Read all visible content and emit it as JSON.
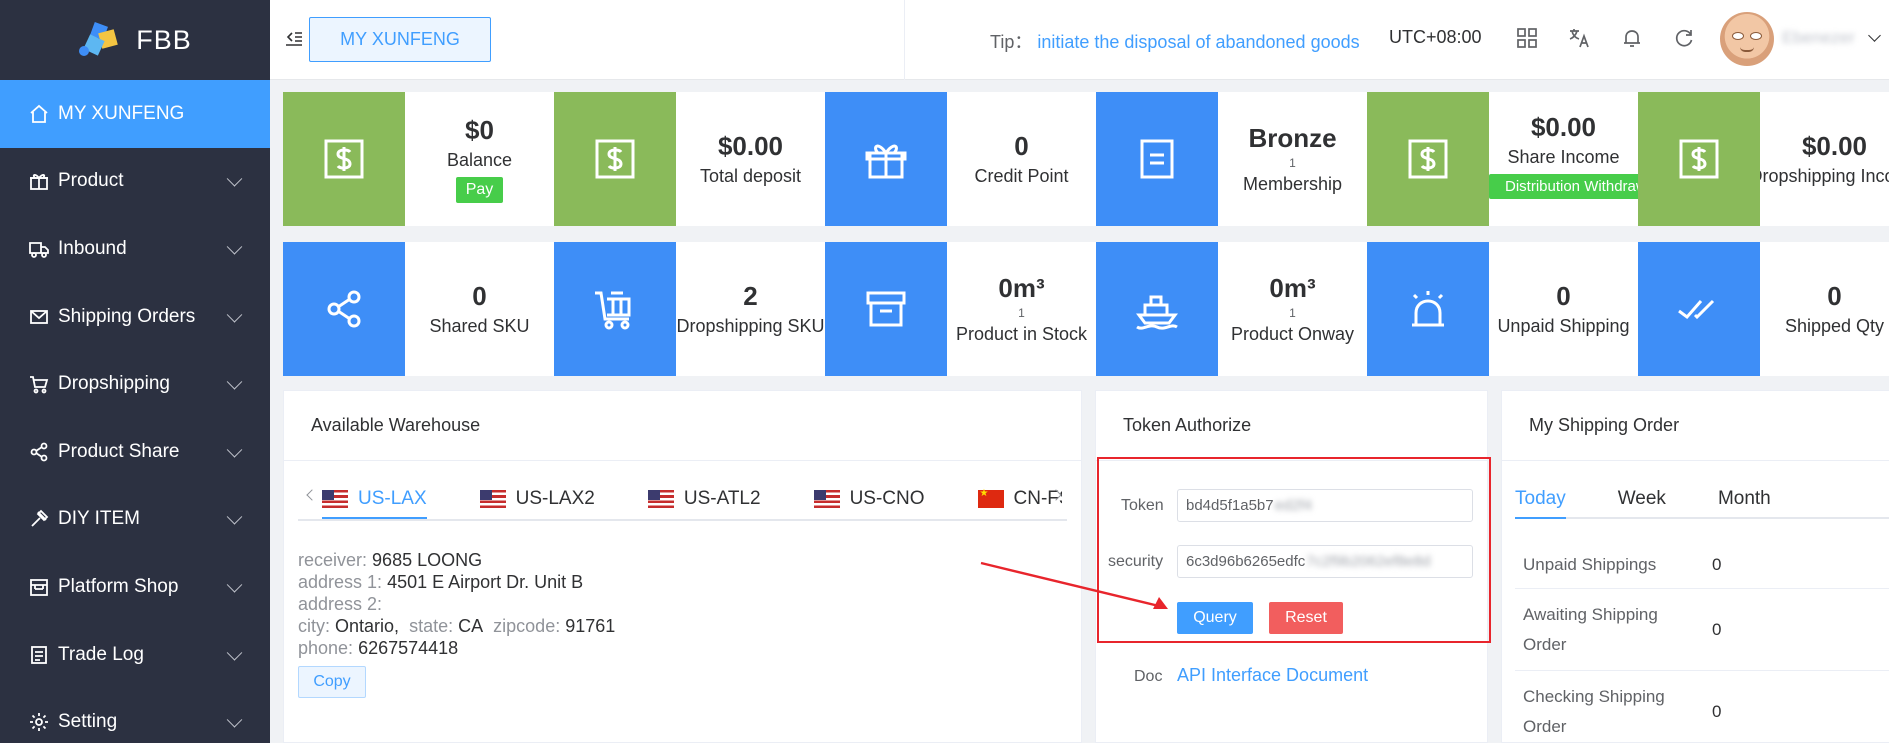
{
  "app": {
    "logo_text": "FBB"
  },
  "sidebar": {
    "items": [
      {
        "label": "MY XUNFENG",
        "icon": "home-icon"
      },
      {
        "label": "Product",
        "icon": "gift-icon"
      },
      {
        "label": "Inbound",
        "icon": "truck-icon"
      },
      {
        "label": "Shipping Orders",
        "icon": "mail-icon"
      },
      {
        "label": "Dropshipping",
        "icon": "cart-icon"
      },
      {
        "label": "Product Share",
        "icon": "share-icon"
      },
      {
        "label": "DIY ITEM",
        "icon": "tools-icon"
      },
      {
        "label": "Platform Shop",
        "icon": "shop-icon"
      },
      {
        "label": "Trade Log",
        "icon": "document-icon"
      },
      {
        "label": "Setting",
        "icon": "gear-icon"
      }
    ]
  },
  "header": {
    "active_tag": "MY XUNFENG",
    "tip_label": "Tip：",
    "tip_link": "initiate the disposal of abandoned goods",
    "timezone": "UTC+08:00",
    "username": "Ebenezer"
  },
  "stats_row1": [
    {
      "value": "$0",
      "label": "Balance",
      "button": "Pay",
      "color": "#8aba5a",
      "icon": "dollar-icon"
    },
    {
      "value": "$0.00",
      "label": "Total deposit",
      "color": "#8aba5a",
      "icon": "dollar-icon"
    },
    {
      "value": "0",
      "label": "Credit Point",
      "color": "#3e8ef7",
      "icon": "gift-icon"
    },
    {
      "value": "Bronze",
      "sub": "1",
      "label": "Membership",
      "color": "#3e8ef7",
      "icon": "document-icon"
    },
    {
      "value": "$0.00",
      "label": "Share Income",
      "button": "Distribution Withdrawal",
      "color": "#8aba5a",
      "icon": "dollar-icon"
    },
    {
      "value": "$0.00",
      "label": "Dropshipping Income",
      "color": "#8aba5a",
      "icon": "dollar-icon"
    }
  ],
  "stats_row2": [
    {
      "value": "0",
      "label": "Shared SKU",
      "icon": "share-icon"
    },
    {
      "value": "2",
      "label": "Dropshipping SKU",
      "icon": "cart-icon"
    },
    {
      "value": "0m³",
      "sub": "1",
      "label": "Product in Stock",
      "icon": "store-icon"
    },
    {
      "value": "0m³",
      "sub": "1",
      "label": "Product Onway",
      "icon": "ship-icon"
    },
    {
      "value": "0",
      "label": "Unpaid Shipping",
      "icon": "alarm-icon"
    },
    {
      "value": "0",
      "label": "Shipped Qty",
      "icon": "check-icon"
    }
  ],
  "warehouse": {
    "title": "Available Warehouse",
    "tabs": [
      "US-LAX",
      "US-LAX2",
      "US-ATL2",
      "US-CNO",
      "CN-FS"
    ],
    "receiver_label": "receiver:",
    "receiver": "9685  LOONG",
    "address1_label": "address 1:",
    "address1": "4501 E Airport Dr. Unit B",
    "address2_label": "address 2:",
    "address2": "",
    "city_label": "city:",
    "city": "Ontario,",
    "state_label": "state:",
    "state": "CA",
    "zip_label": "zipcode:",
    "zip": "91761",
    "phone_label": "phone:",
    "phone": "6267574418",
    "copy_label": "Copy"
  },
  "token": {
    "title": "Token Authorize",
    "token_label": "Token",
    "token_value": "bd4d5f1a5b7",
    "token_hidden": "ed2f4",
    "security_label": "security",
    "security_value": "6c3d96b6265edfc",
    "security_hidden": "7c2f9b2062ef8e8d",
    "query_label": "Query",
    "reset_label": "Reset",
    "doc_label": "Doc",
    "doc_link": "API Interface Document"
  },
  "shipping": {
    "title": "My Shipping Order",
    "tabs": [
      "Today",
      "Week",
      "Month"
    ],
    "rows": [
      {
        "label": "Unpaid Shippings",
        "value": "0"
      },
      {
        "label": "Awaiting Shipping Order",
        "value": "0"
      },
      {
        "label": "Checking Shipping Order",
        "value": "0"
      }
    ]
  }
}
